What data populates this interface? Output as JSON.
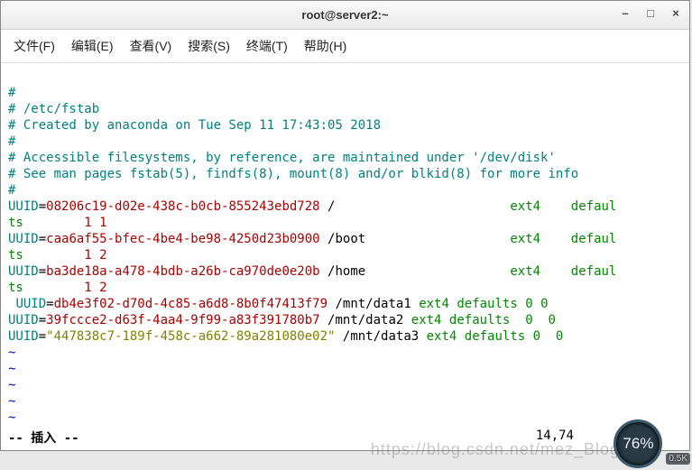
{
  "title": "root@server2:~",
  "menu": {
    "file": "文件(F)",
    "edit": "编辑(E)",
    "view": "查看(V)",
    "search": "搜索(S)",
    "terminal": "终端(T)",
    "help": "帮助(H)"
  },
  "controls": {
    "minimize": "–",
    "maximize": "□",
    "close": "×"
  },
  "lines": {
    "c0": "#",
    "c1": "# /etc/fstab",
    "c2": "# Created by anaconda on Tue Sep 11 17:43:05 2018",
    "c3": "#",
    "c4": "# Accessible filesystems, by reference, are maintained under '/dev/disk'",
    "c5": "# See man pages fstab(5), findfs(8), mount(8) and/or blkid(8) for more info",
    "c6": "#",
    "u1": "UUID",
    "eq": "=",
    "uuid1": "08206c19-d02e-438c-b0cb-855243ebd728",
    "path1": "/",
    "fs": "ext4",
    "opt_wrap1": "defaul",
    "wrap_ts": "ts",
    "num11": "1 1",
    "uuid2": "caa6af55-bfec-4be4-be98-4250d23b0900",
    "path2": "/boot",
    "num12": "1 2",
    "uuid3": "ba3de18a-a478-4bdb-a26b-ca970de0e20b",
    "path3": "/home",
    "sp": " ",
    "uuid4": "db4e3f02-d70d-4c85-a6d8-8b0f47413f79",
    "path4": "/mnt/data1",
    "opts4": "ext4 defaults 0 0",
    "uuid5": "39fccce2-d63f-4aa4-9f99-a83f391780b7",
    "path5": "/mnt/data2",
    "opts5": "ext4 defaults  0  0",
    "uuid6": "\"447838c7-189f-458c-a662-89a281080e02\"",
    "path6": "/mnt/data3",
    "opts6": "ext4 defaults 0  0",
    "tilde": "~"
  },
  "status": {
    "mode": "-- 插入 --",
    "pos": "14,74"
  },
  "watermark": "https://blog.csdn.net/mez_Blog",
  "sensor": {
    "gauge": "76%",
    "net": "0.5K"
  }
}
